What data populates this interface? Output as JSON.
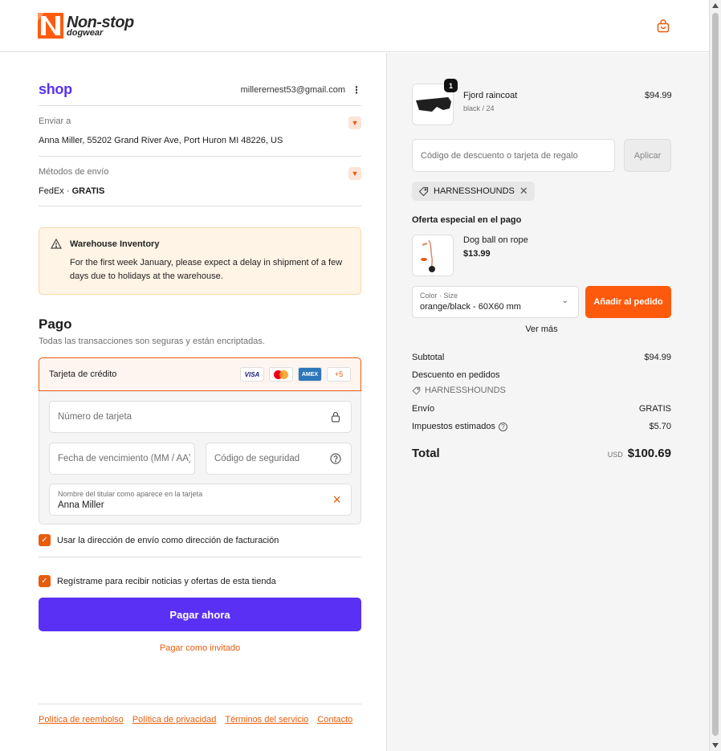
{
  "brand": {
    "line1": "Non-stop",
    "line2": "dogwear",
    "colors": {
      "accent": "#e85c0c",
      "shop_purple": "#5a31f4"
    }
  },
  "shop": {
    "logo": "shop",
    "email": "millerernest53@gmail.com",
    "menu": "⋮"
  },
  "ship_to": {
    "label": "Enviar a",
    "value": "Anna Miller, 55202 Grand River Ave, Port Huron MI 48226, US"
  },
  "shipping_method": {
    "label": "Métodos de envío",
    "carrier": "FedEx · ",
    "price": "GRATIS"
  },
  "notice": {
    "title": "Warehouse Inventory",
    "body": "For the first week January, please expect a delay in shipment of a few days due to holidays at the warehouse."
  },
  "payment": {
    "title": "Pago",
    "subtitle": "Todas las transacciones son seguras y están encriptadas.",
    "method_label": "Tarjeta de crédito",
    "brands": {
      "visa": "VISA",
      "amex": "AMEX",
      "more": "+5"
    },
    "card_number_placeholder": "Número de tarjeta",
    "expiry_placeholder": "Fecha de vencimiento (MM / AA)",
    "cvv_placeholder": "Código de seguridad",
    "holder_label": "Nombre del titular como aparece en la tarjeta",
    "holder_value": "Anna Miller"
  },
  "checkboxes": {
    "billing": "Usar la dirección de envío como dirección de facturación",
    "newsletter": "Regístrame para recibir noticias y ofertas de esta tienda"
  },
  "actions": {
    "pay_now": "Pagar ahora",
    "guest": "Pagar como invitado"
  },
  "footer": {
    "links": [
      "Política de reembolso",
      "Política de privacidad",
      "Términos del servicio",
      "Contacto"
    ]
  },
  "order": {
    "item": {
      "name": "Fjord raincoat",
      "variant": "black / 24",
      "price": "$94.99",
      "qty": "1"
    },
    "discount_placeholder": "Código de descuento o tarjeta de regalo",
    "apply": "Aplicar",
    "applied_code": "HARNESSHOUNDS",
    "offer": {
      "title": "Oferta especial en el pago",
      "name": "Dog ball on rope",
      "price": "$13.99",
      "select_label": "Color · Size",
      "select_value": "orange/black - 60X60 mm",
      "add": "Añadir al pedido",
      "more": "Ver más"
    },
    "summary": {
      "subtotal_label": "Subtotal",
      "subtotal": "$94.99",
      "discount_label": "Descuento en pedidos",
      "discount_code": "HARNESSHOUNDS",
      "shipping_label": "Envío",
      "shipping": "GRATIS",
      "tax_label": "Impuestos estimados",
      "tax": "$5.70",
      "total_label": "Total",
      "currency": "USD",
      "total": "$100.69"
    }
  }
}
